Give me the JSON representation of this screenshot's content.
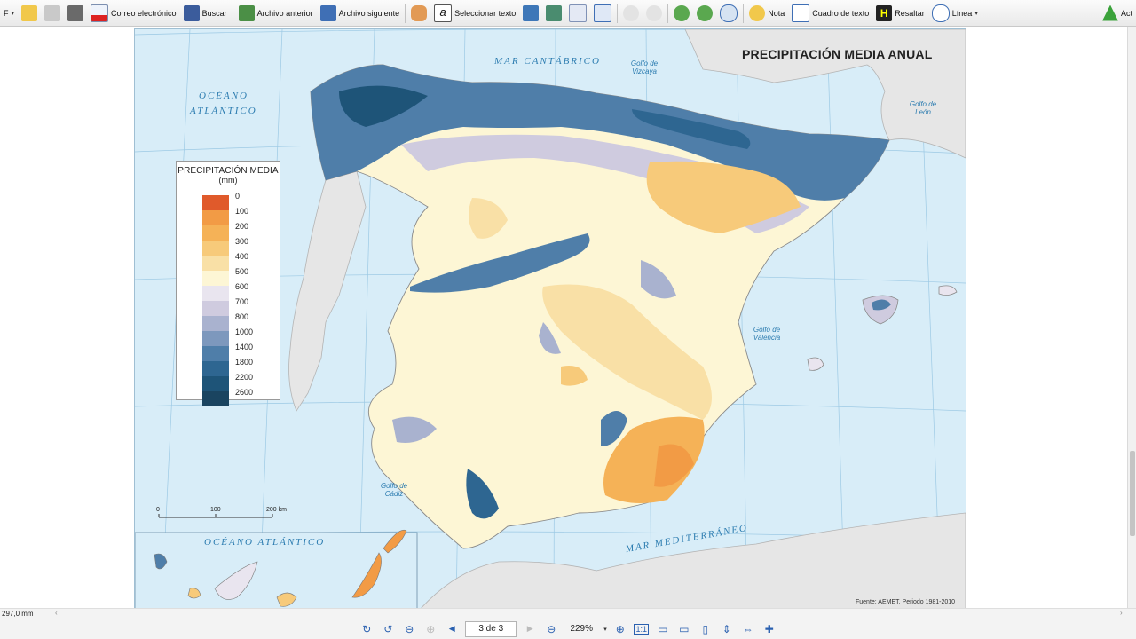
{
  "toolbar": {
    "items": [
      "Correo electrónico",
      "Buscar",
      "Archivo anterior",
      "Archivo siguiente",
      "Seleccionar texto",
      "Nota",
      "Cuadro de texto",
      "Resaltar",
      "Línea",
      "Act"
    ]
  },
  "map": {
    "title": "PRECIPITACIÓN MEDIA ANUAL",
    "source": "Fuente: AEMET. Periodo 1981-2010",
    "seas": {
      "cantabrico": "MAR CANTÁBRICO",
      "oceano_l1": "OCÉANO",
      "oceano_l2": "ATLÁNTICO",
      "mediterraneo": "MAR MEDITERRÁNEO",
      "oceano_canarias": "OCÉANO ATLÁNTICO"
    },
    "gulfs": {
      "vizcaya": "Golfo de Vizcaya",
      "leon": "Golfo de León",
      "valencia": "Golfo de Valencia",
      "cadiz": "Golfo de Cádiz"
    },
    "scale": {
      "labels": [
        "0",
        "100",
        "200 km"
      ]
    },
    "legend": {
      "title": "PRECIPITACIÓN MEDIA",
      "unit": "(mm)",
      "classes": [
        {
          "label": "0",
          "color": "#e05a2b"
        },
        {
          "label": "100",
          "color": "#f29b45"
        },
        {
          "label": "200",
          "color": "#f5b257"
        },
        {
          "label": "300",
          "color": "#f7ca7a"
        },
        {
          "label": "400",
          "color": "#f9e0a6"
        },
        {
          "label": "500",
          "color": "#fdf6d5"
        },
        {
          "label": "600",
          "color": "#e9e5ef"
        },
        {
          "label": "700",
          "color": "#cfcbdf"
        },
        {
          "label": "800",
          "color": "#a9b2cf"
        },
        {
          "label": "1000",
          "color": "#7d98bd"
        },
        {
          "label": "1400",
          "color": "#4f7ea9"
        },
        {
          "label": "1800",
          "color": "#2e6691"
        },
        {
          "label": "2200",
          "color": "#1e5478"
        },
        {
          "label": "2600",
          "color": "#1a4460"
        }
      ]
    }
  },
  "status": {
    "page_size": "297,0 mm",
    "page_indicator": "3 de 3",
    "zoom": "229%"
  }
}
